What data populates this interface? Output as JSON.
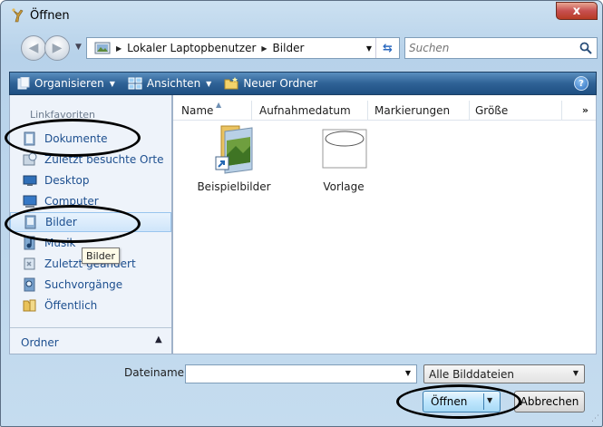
{
  "window": {
    "title": "Öffnen",
    "close_label": "x"
  },
  "address": {
    "crumbs": [
      "Lokaler Laptopbenutzer",
      "Bilder"
    ],
    "search_placeholder": "Suchen"
  },
  "toolbar": {
    "organize": "Organisieren",
    "views": "Ansichten",
    "new_folder": "Neuer Ordner",
    "help": "?"
  },
  "left_pane": {
    "heading": "Linkfavoriten",
    "items": [
      {
        "label": "Dokumente",
        "icon": "documents-icon"
      },
      {
        "label": "Zuletzt besuchte Orte",
        "icon": "recent-places-icon"
      },
      {
        "label": "Desktop",
        "icon": "desktop-icon"
      },
      {
        "label": "Computer",
        "icon": "computer-icon"
      },
      {
        "label": "Bilder",
        "icon": "pictures-icon"
      },
      {
        "label": "Musik",
        "icon": "music-icon"
      },
      {
        "label": "Zuletzt geändert",
        "icon": "recently-changed-icon"
      },
      {
        "label": "Suchvorgänge",
        "icon": "searches-icon"
      },
      {
        "label": "Öffentlich",
        "icon": "public-folder-icon"
      }
    ],
    "selected_item": "Bilder",
    "folders_label": "Ordner",
    "tooltip": "Bilder"
  },
  "columns": [
    "Name",
    "Aufnahmedatum",
    "Markierungen",
    "Größe"
  ],
  "columns_more": "»",
  "files": [
    {
      "name": "Beispielbilder",
      "icon": "folder-shortcut-icon"
    },
    {
      "name": "Vorlage",
      "icon": "image-thumbnail-icon"
    }
  ],
  "bottom": {
    "filename_label": "Dateiname:",
    "filename_value": "",
    "filter_value": "Alle Bilddateien",
    "open_label": "Öffnen",
    "cancel_label": "Abbrechen"
  },
  "colors": {
    "toolbar": "#2f6296",
    "link": "#1d4f8f",
    "close": "#c75050"
  }
}
